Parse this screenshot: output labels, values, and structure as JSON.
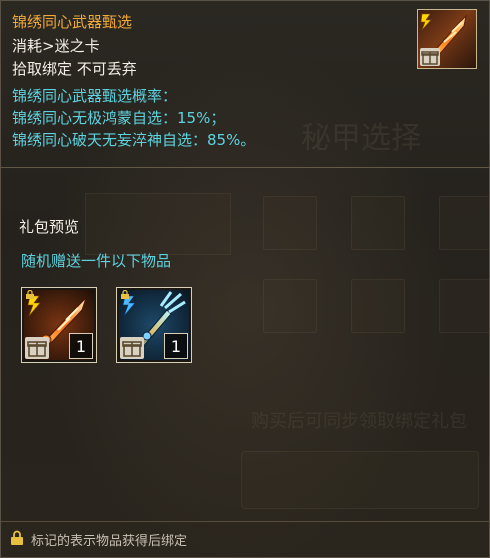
{
  "tooltip": {
    "title": "锦绣同心武器甄选",
    "consume": "消耗>迷之卡",
    "binding": "拾取绑定 不可丢弃",
    "rates": [
      "锦绣同心武器甄选概率：",
      "锦绣同心无极鸿蒙自选：15%；",
      "锦绣同心破天无妄淬神自选：85%。"
    ],
    "icon": "flaming-sword-icon"
  },
  "gift": {
    "heading": "礼包预览",
    "subtitle": "随机赠送一件以下物品",
    "items": [
      {
        "name": "fire-sword",
        "count": "1"
      },
      {
        "name": "ice-trident",
        "count": "1"
      }
    ]
  },
  "footer": {
    "note": "标记的表示物品获得后绑定"
  },
  "colors": {
    "title": "#f2a93b",
    "text": "#f3efe6",
    "cyan": "#5ed3df"
  }
}
